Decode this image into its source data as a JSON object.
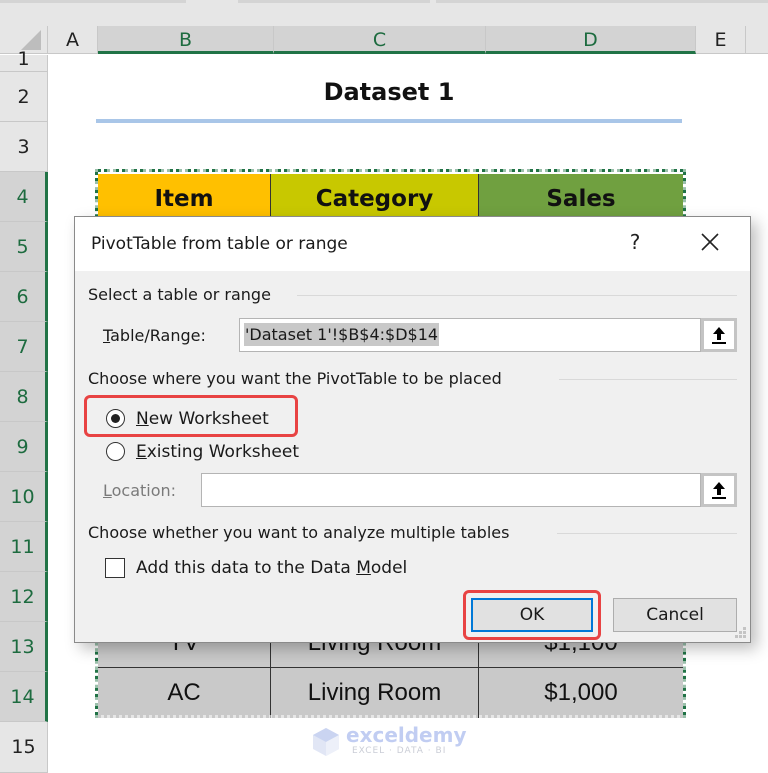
{
  "spreadsheet": {
    "columns": [
      {
        "label": "A",
        "selected": false
      },
      {
        "label": "B",
        "selected": true
      },
      {
        "label": "C",
        "selected": true
      },
      {
        "label": "D",
        "selected": true
      },
      {
        "label": "E",
        "selected": false
      }
    ],
    "rows": [
      "1",
      "2",
      "3",
      "4",
      "5",
      "6",
      "7",
      "8",
      "9",
      "10",
      "11",
      "12",
      "13",
      "14",
      "15"
    ],
    "selected_rows": [
      "4",
      "5",
      "6",
      "7",
      "8",
      "9",
      "10",
      "11",
      "12",
      "13",
      "14"
    ],
    "title": "Dataset 1",
    "table": {
      "headers": [
        {
          "label": "Item",
          "color": "#ffc000"
        },
        {
          "label": "Category",
          "color": "#c8c800"
        },
        {
          "label": "Sales",
          "color": "#70a040"
        }
      ],
      "visible_rows": [
        {
          "item": "TV",
          "category": "Living Room",
          "sales": "$1,100"
        },
        {
          "item": "AC",
          "category": "Living Room",
          "sales": "$1,000"
        }
      ]
    },
    "watermark": {
      "brand": "exceldemy",
      "tagline": "EXCEL · DATA · BI"
    }
  },
  "dialog": {
    "title": "PivotTable from table or range",
    "help_label": "?",
    "section_select": "Select a table or range",
    "table_range_label_prefix": "",
    "table_range_label_accel": "T",
    "table_range_label_rest": "able/Range:",
    "table_range_value": "'Dataset 1'!$B$4:$D$14",
    "section_place": "Choose where you want the PivotTable to be placed",
    "option_new": {
      "accel": "N",
      "rest": "ew Worksheet",
      "checked": true
    },
    "option_existing": {
      "accel": "E",
      "rest": "xisting Worksheet",
      "checked": false
    },
    "location_label_accel": "L",
    "location_label_rest": "ocation:",
    "location_value": "",
    "section_multiple": "Choose whether you want to analyze multiple tables",
    "data_model_prefix": "Add this data to the Data ",
    "data_model_accel": "M",
    "data_model_rest": "odel",
    "data_model_checked": false,
    "ok_label": "OK",
    "cancel_label": "Cancel",
    "highlight_color": "#e84343"
  }
}
